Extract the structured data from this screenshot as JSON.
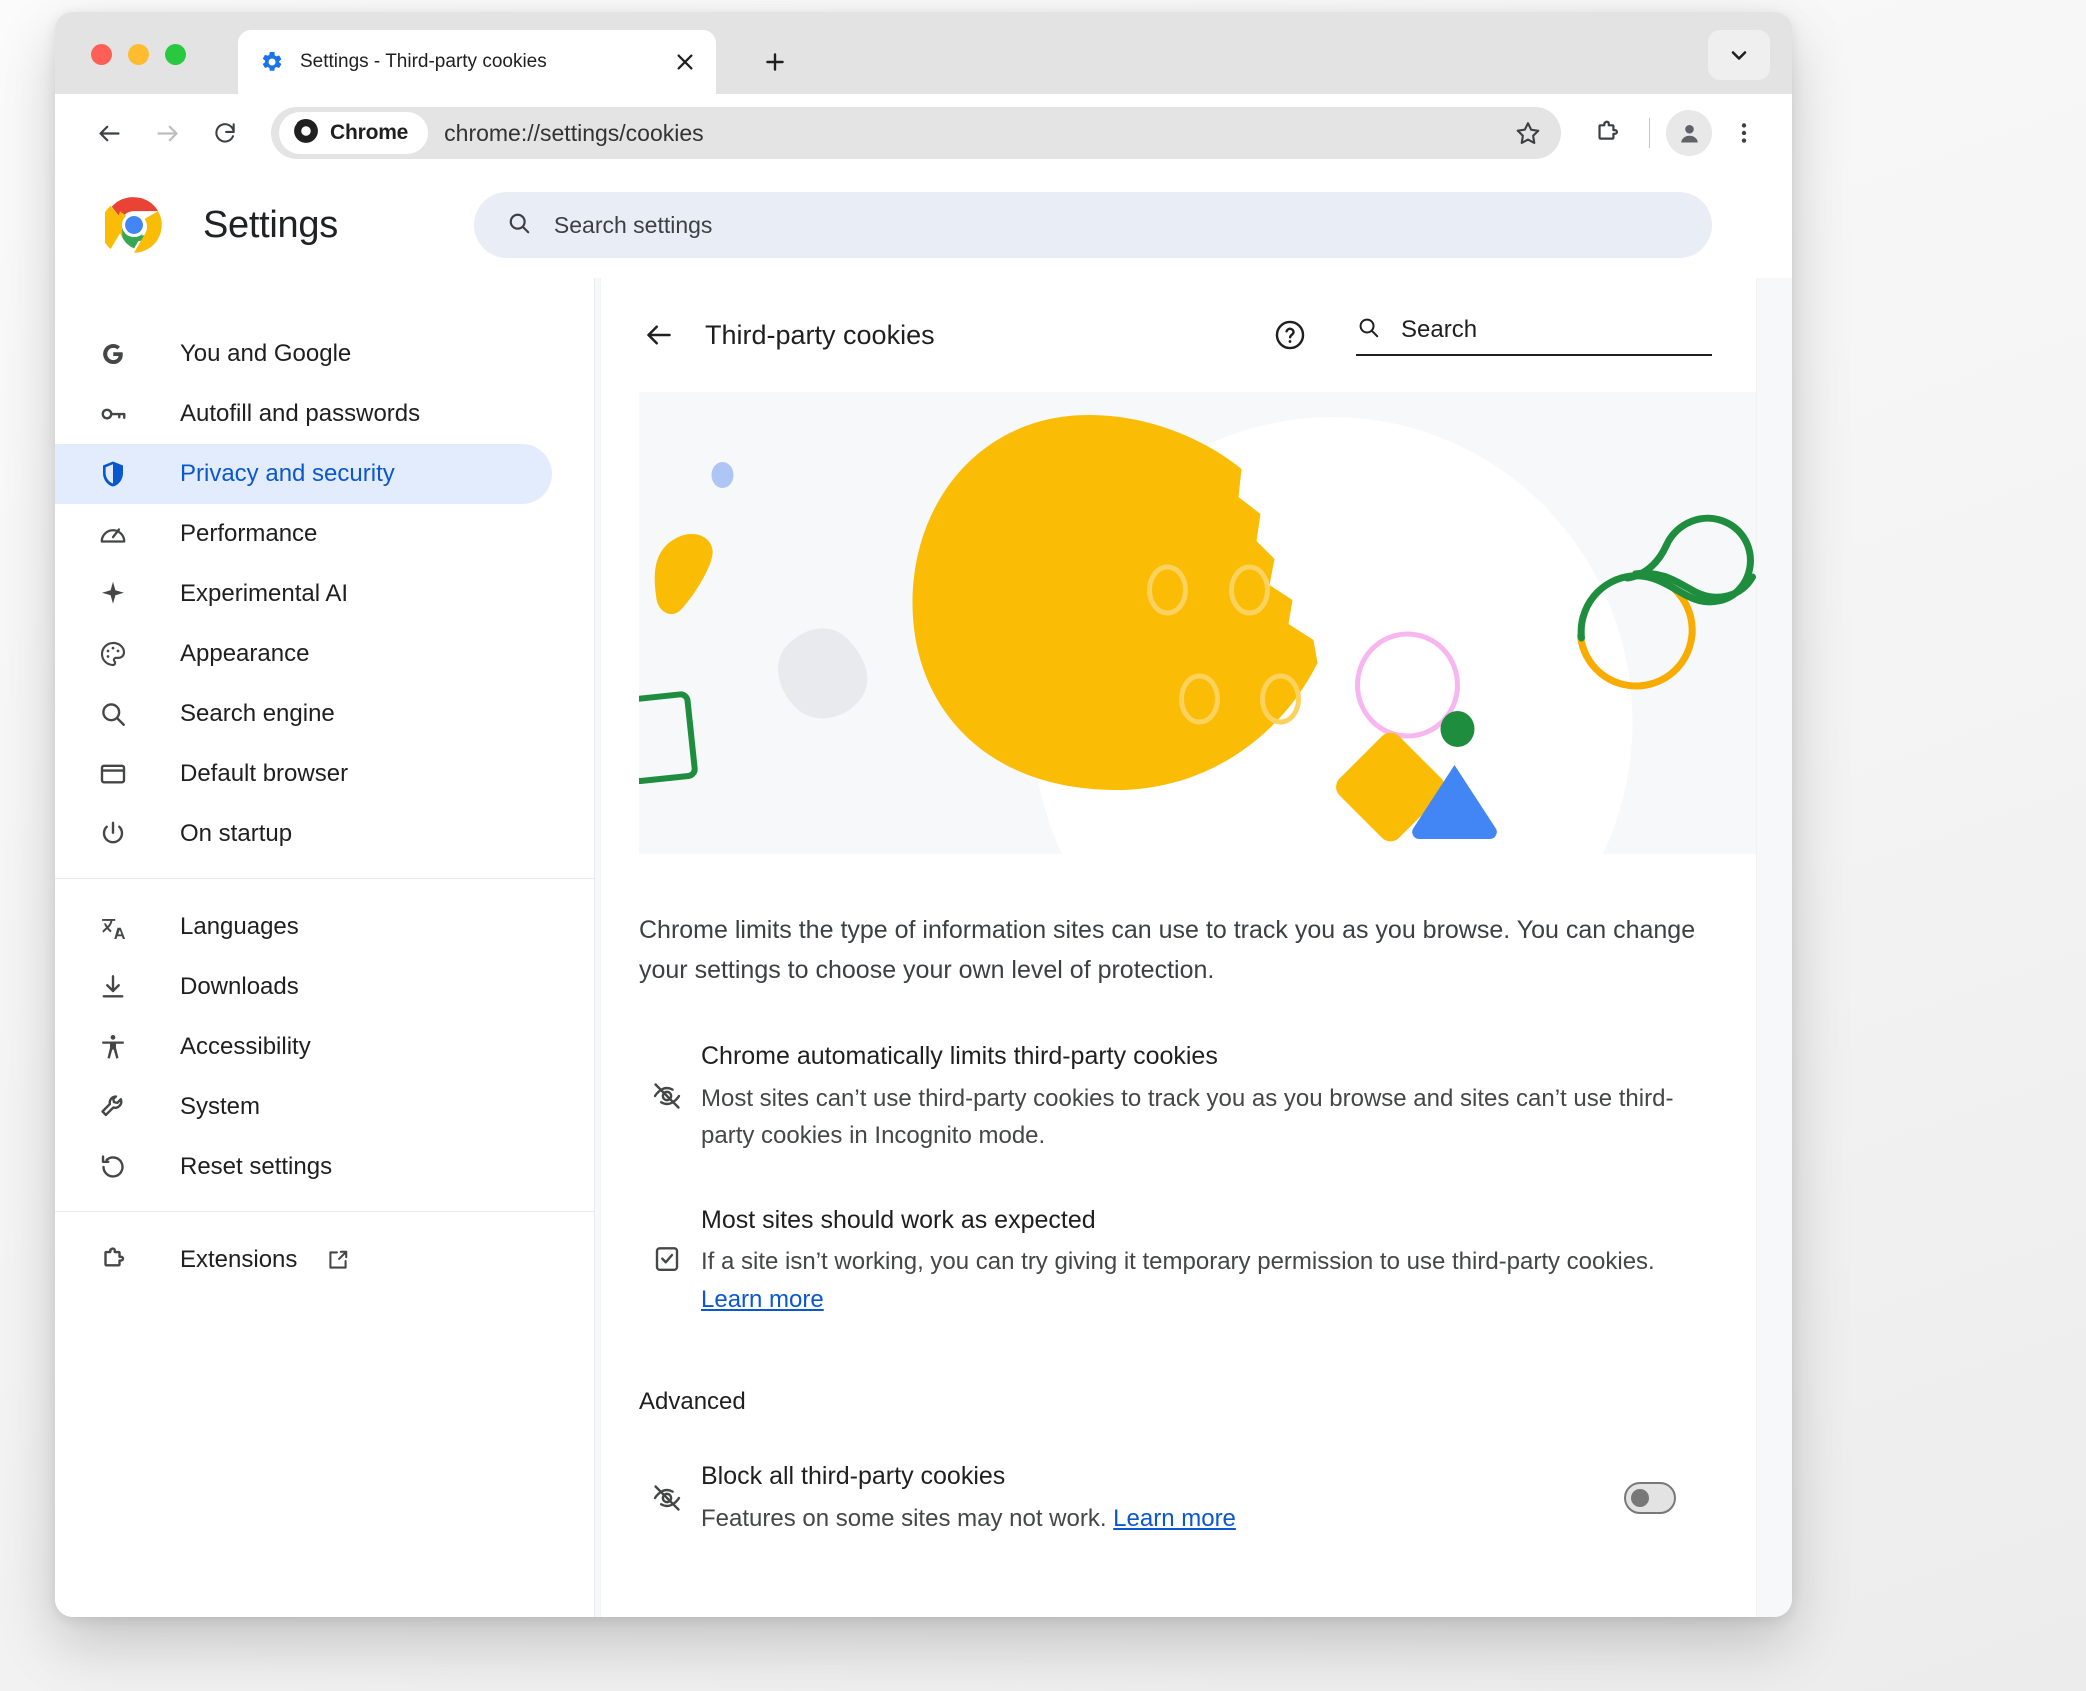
{
  "window": {
    "traffic_lights": [
      "close",
      "minimize",
      "maximize"
    ]
  },
  "tab_strip": {
    "active_tab": {
      "title": "Settings - Third-party cookies",
      "favicon": "settings-gear-icon",
      "close_icon": "close-icon"
    },
    "new_tab_icon": "plus-icon",
    "tab_list_icon": "chevron-down-icon"
  },
  "toolbar": {
    "back_icon": "back-arrow-icon",
    "forward_icon": "forward-arrow-icon",
    "reload_icon": "reload-icon",
    "chrome_chip_label": "Chrome",
    "chrome_chip_icon": "chrome-mono-icon",
    "url": "chrome://settings/cookies",
    "bookmark_icon": "star-icon",
    "extensions_icon": "puzzle-piece-icon",
    "profile_icon": "person-icon",
    "menu_icon": "three-dot-menu-icon"
  },
  "settings_header": {
    "logo": "chrome-logo-icon",
    "title": "Settings",
    "search_icon": "search-icon",
    "search_placeholder": "Search settings",
    "search_value": ""
  },
  "sidebar": {
    "groups": [
      {
        "items": [
          {
            "label": "You and Google",
            "icon": "google-g-icon",
            "selected": false
          },
          {
            "label": "Autofill and passwords",
            "icon": "key-icon",
            "selected": false
          },
          {
            "label": "Privacy and security",
            "icon": "shield-icon",
            "selected": true
          },
          {
            "label": "Performance",
            "icon": "speedometer-icon",
            "selected": false
          },
          {
            "label": "Experimental AI",
            "icon": "sparkle-icon",
            "selected": false
          },
          {
            "label": "Appearance",
            "icon": "palette-icon",
            "selected": false
          },
          {
            "label": "Search engine",
            "icon": "search-icon",
            "selected": false
          },
          {
            "label": "Default browser",
            "icon": "browser-window-icon",
            "selected": false
          },
          {
            "label": "On startup",
            "icon": "power-icon",
            "selected": false
          }
        ]
      },
      {
        "items": [
          {
            "label": "Languages",
            "icon": "translate-icon",
            "selected": false
          },
          {
            "label": "Downloads",
            "icon": "download-icon",
            "selected": false
          },
          {
            "label": "Accessibility",
            "icon": "accessibility-icon",
            "selected": false
          },
          {
            "label": "System",
            "icon": "wrench-icon",
            "selected": false
          },
          {
            "label": "Reset settings",
            "icon": "reset-icon",
            "selected": false
          }
        ]
      },
      {
        "items": [
          {
            "label": "Extensions",
            "icon": "puzzle-piece-icon",
            "selected": false,
            "external": true,
            "external_icon": "open-in-new-icon"
          }
        ]
      }
    ]
  },
  "page": {
    "back_icon": "back-arrow-icon",
    "title": "Third-party cookies",
    "help_icon": "help-circle-icon",
    "search_icon": "search-icon",
    "search_placeholder": "Search",
    "search_value": "",
    "hero_illustration": "cookie-illustration",
    "intro": "Chrome limits the type of information sites can use to track you as you browse. You can change your settings to choose your own level of protection.",
    "bullets": [
      {
        "icon": "eye-off-icon",
        "title": "Chrome automatically limits third-party cookies",
        "desc": "Most sites can’t use third-party cookies to track you as you browse and sites can’t use third-party cookies in Incognito mode.",
        "link_label": ""
      },
      {
        "icon": "checkbox-checked-icon",
        "title": "Most sites should work as expected",
        "desc": "If a site isn’t working, you can try giving it temporary permission to use third-party cookies.",
        "link_label": "Learn more"
      }
    ],
    "advanced_heading": "Advanced",
    "advanced_row": {
      "icon": "eye-off-icon",
      "title": "Block all third-party cookies",
      "desc": "Features on some sites may not work.",
      "link_label": "Learn more",
      "toggle_state": "off"
    }
  },
  "colors": {
    "accent_blue": "#0b57d0",
    "selected_nav_bg": "#e3ecfd",
    "cookie_yellow": "#fabc05",
    "green": "#1e8e3e",
    "blue_triangle": "#4285f4",
    "pink_circle": "#f8b6f0",
    "hero_bg": "#f6f8fa"
  }
}
